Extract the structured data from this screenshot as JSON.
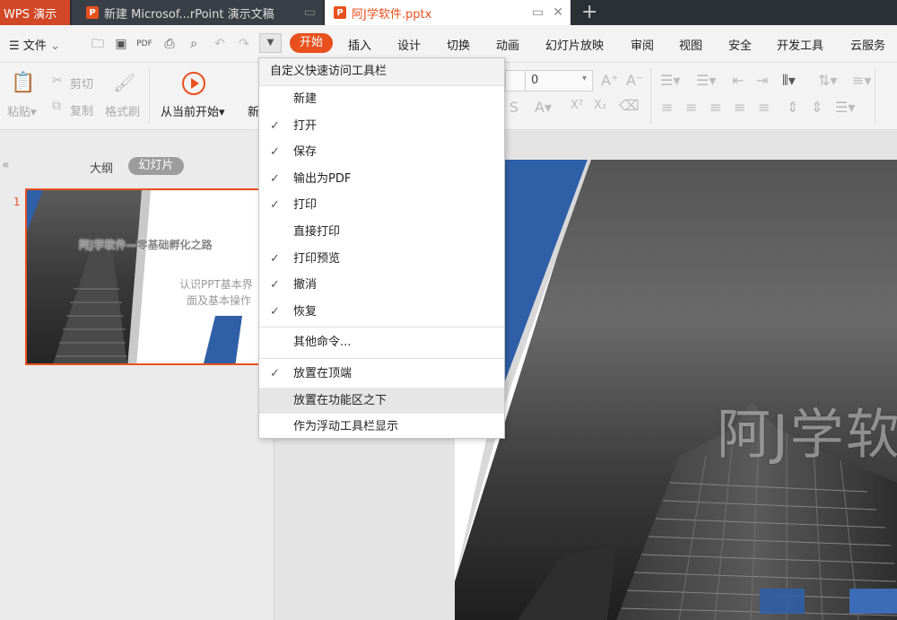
{
  "tabs": {
    "app_name": "WPS 演示",
    "doc1_title": "新建 Microsof...rPoint 演示文稿",
    "doc2_title": "阿J学软件.pptx",
    "icon_letter": "P",
    "add_symbol": "+"
  },
  "menubar": {
    "file_label": "文件",
    "tabs": [
      "开始",
      "插入",
      "设计",
      "切换",
      "动画",
      "幻灯片放映",
      "审阅",
      "视图",
      "安全",
      "开发工具",
      "云服务"
    ]
  },
  "ribbon": {
    "paste": "粘贴",
    "cut": "剪切",
    "copy": "复制",
    "format_painter": "格式刷",
    "from_current": "从当前开始",
    "new_partial": "新",
    "font_size": "0"
  },
  "leftpane": {
    "outline": "大纲",
    "slides": "幻灯片",
    "slide_number": "1",
    "thumb_title": "阿J学软件—零基础孵化之路",
    "thumb_subtitle_1": "认识PPT基本界",
    "thumb_subtitle_2": "面及基本操作"
  },
  "slide": {
    "title_partial": "阿J学软"
  },
  "qat_menu": {
    "header": "自定义快速访问工具栏",
    "items": [
      {
        "label": "新建",
        "checked": false
      },
      {
        "label": "打开",
        "checked": true
      },
      {
        "label": "保存",
        "checked": true
      },
      {
        "label": "输出为PDF",
        "checked": true
      },
      {
        "label": "打印",
        "checked": true
      },
      {
        "label": "直接打印",
        "checked": false
      },
      {
        "label": "打印预览",
        "checked": true
      },
      {
        "label": "撤消",
        "checked": true
      },
      {
        "label": "恢复",
        "checked": true
      }
    ],
    "more_commands": "其他命令...",
    "position_items": [
      {
        "label": "放置在顶端",
        "checked": true
      },
      {
        "label": "放置在功能区之下",
        "checked": false
      },
      {
        "label": "作为浮动工具栏显示",
        "checked": false
      }
    ]
  },
  "colors": {
    "accent": "#e8501e",
    "app_tab": "#d24726",
    "slide_blue": "#2f5fa7"
  }
}
